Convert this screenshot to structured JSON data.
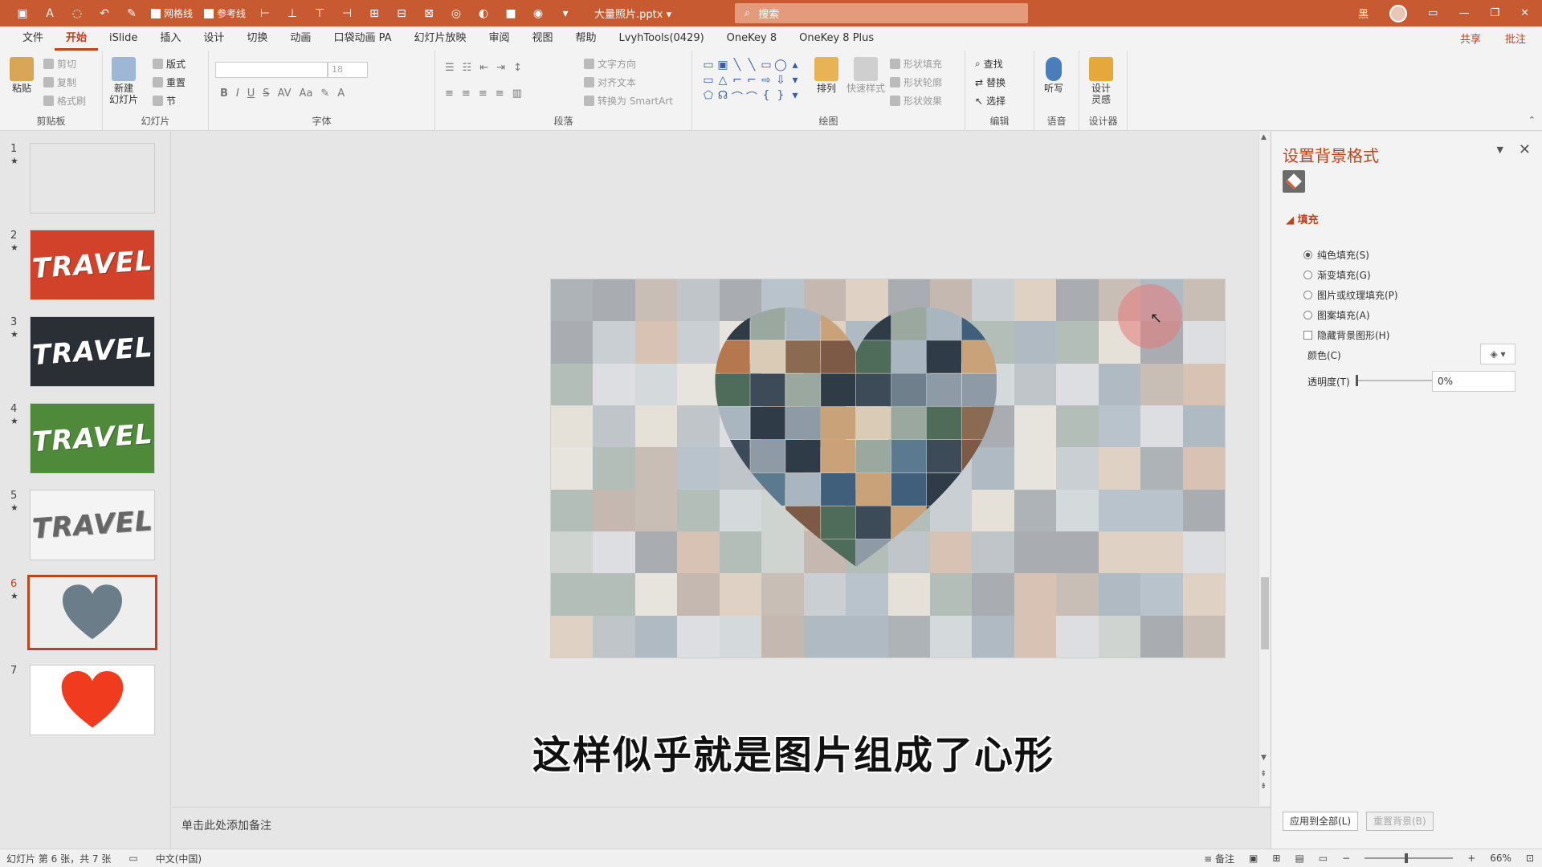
{
  "titlebar": {
    "gridlines": "网格线",
    "guides": "参考线",
    "doc_title": "大量照片.pptx",
    "doc_title_arrow": "▾",
    "search_placeholder": "搜索",
    "user": "黑"
  },
  "tabs": [
    "文件",
    "开始",
    "iSlide",
    "插入",
    "设计",
    "切换",
    "动画",
    "口袋动画 PA",
    "幻灯片放映",
    "审阅",
    "视图",
    "帮助",
    "LvyhTools(0429)",
    "OneKey 8",
    "OneKey 8 Plus"
  ],
  "active_tab": "开始",
  "tab_right": {
    "share": "共享",
    "comment": "批注"
  },
  "ribbon": {
    "clipboard": {
      "label": "剪贴板",
      "paste": "粘贴",
      "cut": "剪切",
      "copy": "复制",
      "format_painter": "格式刷"
    },
    "slides": {
      "label": "幻灯片",
      "new_slide": "新建\n幻灯片",
      "layout": "版式",
      "reset": "重置",
      "section": "节"
    },
    "font": {
      "label": "字体",
      "size": "18"
    },
    "paragraph": {
      "label": "段落",
      "text_direction": "文字方向",
      "align_text": "对齐文本",
      "smartart": "转换为 SmartArt"
    },
    "drawing": {
      "label": "绘图",
      "arrange": "排列",
      "quick_styles": "快速样式",
      "shape_fill": "形状填充",
      "shape_outline": "形状轮廓",
      "shape_effects": "形状效果"
    },
    "editing": {
      "label": "编辑",
      "find": "查找",
      "replace": "替换",
      "select": "选择"
    },
    "voice": {
      "label": "语音",
      "dictate": "听写"
    },
    "designer": {
      "label": "设计器",
      "design_ideas": "设计\n灵感"
    }
  },
  "slides": [
    {
      "num": "1",
      "star": "★",
      "kind": "mosaic"
    },
    {
      "num": "2",
      "star": "★",
      "kind": "travel-red",
      "text": "TRAVEL"
    },
    {
      "num": "3",
      "star": "★",
      "kind": "travel-dark",
      "text": "TRAVEL"
    },
    {
      "num": "4",
      "star": "★",
      "kind": "travel-green",
      "text": "TRAVEL"
    },
    {
      "num": "5",
      "star": "★",
      "kind": "travel-white",
      "text": "TRAVEL"
    },
    {
      "num": "6",
      "star": "★",
      "kind": "heart-photos",
      "selected": true
    },
    {
      "num": "7",
      "star": "",
      "kind": "heart-red"
    }
  ],
  "subtitle": "这样似乎就是图片组成了心形",
  "notes_placeholder": "单击此处添加备注",
  "pane": {
    "title": "设置背景格式",
    "section": "填充",
    "options": [
      {
        "label": "纯色填充(S)",
        "type": "radio",
        "checked": true
      },
      {
        "label": "渐变填充(G)",
        "type": "radio",
        "checked": false
      },
      {
        "label": "图片或纹理填充(P)",
        "type": "radio",
        "checked": false
      },
      {
        "label": "图案填充(A)",
        "type": "radio",
        "checked": false
      },
      {
        "label": "隐藏背景图形(H)",
        "type": "checkbox",
        "checked": false
      }
    ],
    "color_label": "颜色(C)",
    "transparency_label": "透明度(T)",
    "transparency_value": "0%",
    "apply_all": "应用到全部(L)",
    "reset_bg": "重置背景(B)"
  },
  "status": {
    "slide_info": "幻灯片 第 6 张，共 7 张",
    "language": "中文(中国)",
    "notes": "备注",
    "zoom": "66%"
  },
  "colors": {
    "accent": "#c75a30",
    "tab_active": "#c0421c"
  }
}
